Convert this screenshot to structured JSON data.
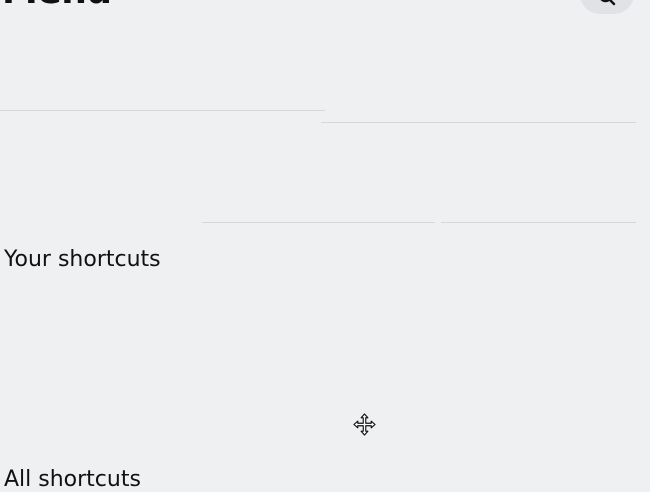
{
  "page": {
    "title": "Menu"
  },
  "header": {
    "search_icon": "search-icon"
  },
  "sections": {
    "your_shortcuts": "Your shortcuts",
    "all_shortcuts": "All shortcuts"
  },
  "cursor": {
    "icon": "move-cursor-icon"
  },
  "colors": {
    "background": "#eff0f2",
    "text": "#111114",
    "divider": "#d6d7da",
    "button_bg": "#e1e2e6"
  }
}
